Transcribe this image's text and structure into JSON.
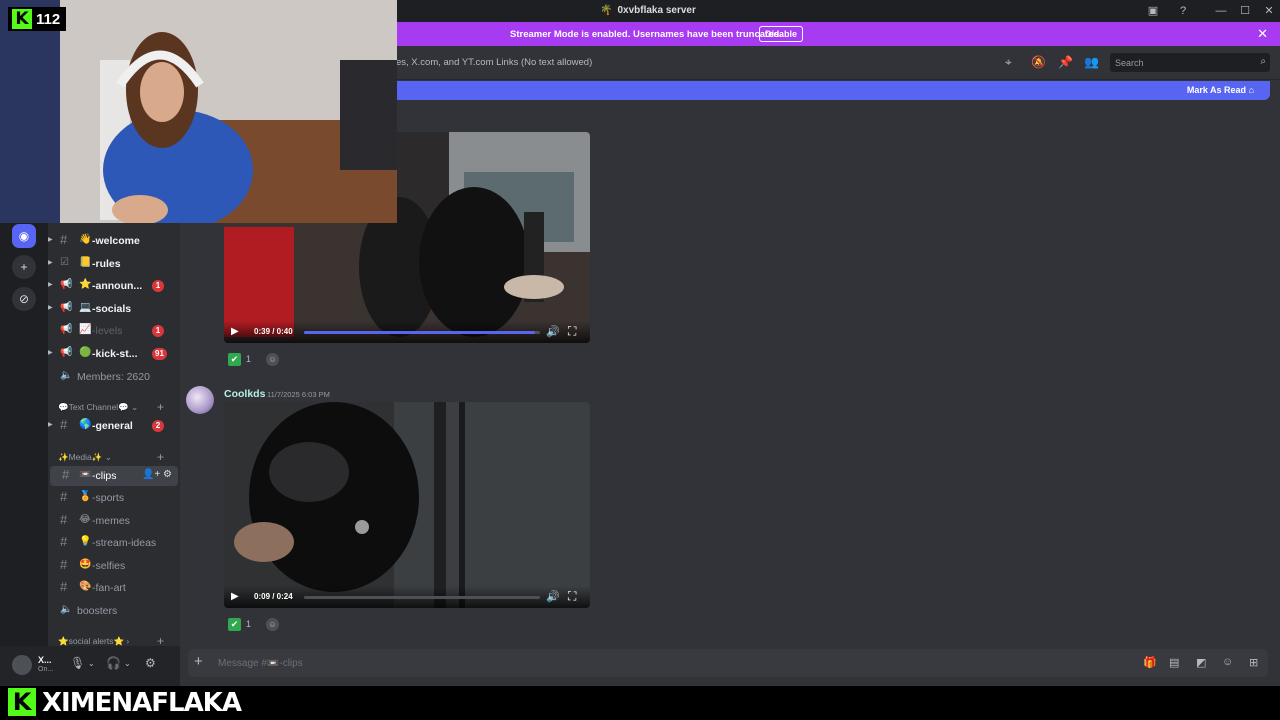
{
  "window": {
    "title": "0xvbflaka server",
    "icons": [
      "screen-share-icon",
      "help-icon",
      "minimize-icon",
      "maximize-icon",
      "close-icon"
    ]
  },
  "banner": {
    "text": "Streamer Mode is enabled. Usernames have been truncated.",
    "button": "Disable",
    "color": "#a63bf2"
  },
  "webcam": {
    "platform": "K",
    "viewer_count": "112",
    "accent": "#53fc18"
  },
  "server_rail": {
    "items": [
      "camera-icon",
      "add-server-icon",
      "discover-icon"
    ]
  },
  "channels": {
    "items": [
      {
        "emoji": "👋",
        "name": "-welcome",
        "badge": "",
        "icon": "#"
      },
      {
        "emoji": "📒",
        "name": "-rules",
        "badge": "",
        "icon": "☑"
      },
      {
        "emoji": "⭐",
        "name": "-announ...",
        "badge": "1",
        "icon": "📢"
      },
      {
        "emoji": "💻",
        "name": "-socials",
        "badge": "",
        "icon": "📢"
      },
      {
        "emoji": "📈",
        "name": "-levels",
        "badge": "1",
        "icon": "📢"
      },
      {
        "emoji": "🟢",
        "name": "-kick-st...",
        "badge": "91",
        "icon": "📢"
      }
    ],
    "members": "Members: 2620",
    "categories": {
      "text": "💬Text Channel💬",
      "media": "✨Media✨",
      "social": "⭐social alerts⭐"
    },
    "general": {
      "emoji": "🌎",
      "name": "-general",
      "badge": "2"
    },
    "media_items": [
      {
        "emoji": "📼",
        "name": "-clips"
      },
      {
        "emoji": "🏅",
        "name": "-sports"
      },
      {
        "emoji": "😂",
        "name": "-memes"
      },
      {
        "emoji": "💡",
        "name": "-stream-ideas"
      },
      {
        "emoji": "🤩",
        "name": "-selfies"
      },
      {
        "emoji": "🎨",
        "name": "-fan-art"
      }
    ],
    "boosters": "boosters"
  },
  "user": {
    "name": "X...",
    "status": "On..."
  },
  "header": {
    "topic": "es, X.com, and YT.com Links (No text allowed)",
    "search_placeholder": "Search",
    "icons": [
      "threads-icon",
      "mute-icon",
      "pin-icon",
      "members-icon"
    ]
  },
  "new_messages": {
    "mark_as_read": "Mark As Read"
  },
  "messages": [
    {
      "video_time": "0:39 / 0:40",
      "progress": 0.98,
      "reaction_count": "1"
    },
    {
      "author": "Coolkds",
      "timestamp": "11/7/2025 6:03 PM",
      "video_time": "0:09 / 0:24",
      "progress": 0.0,
      "reaction_count": "1"
    }
  ],
  "composer": {
    "placeholder": "Message #📼-clips"
  },
  "brand": {
    "logo": "K",
    "name": "XIMENAFLAKA"
  },
  "colors": {
    "accent": "#5865f2",
    "bg": "#313338",
    "sidebar": "#2b2d31",
    "rail": "#1e1f22",
    "badge": "#da373c"
  }
}
